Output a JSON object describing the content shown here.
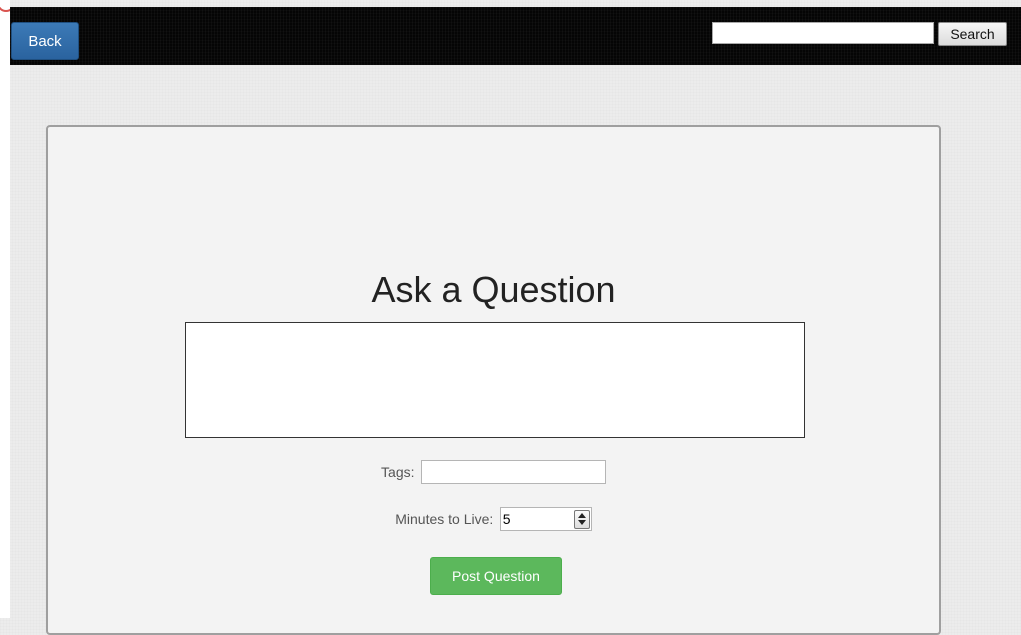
{
  "navbar": {
    "back_label": "Back",
    "search_value": "",
    "search_label": "Search"
  },
  "form": {
    "title": "Ask a Question",
    "question_value": "",
    "tags_label": "Tags:",
    "tags_value": "",
    "minutes_label": "Minutes to Live:",
    "minutes_value": "5",
    "post_label": "Post Question"
  },
  "colors": {
    "navbar_bg": "#050505",
    "back_button": "#2f6ca8",
    "post_button": "#5cb85c",
    "page_bg": "#ececec"
  },
  "icons": {
    "spinner": "spinner-arrows-icon"
  }
}
